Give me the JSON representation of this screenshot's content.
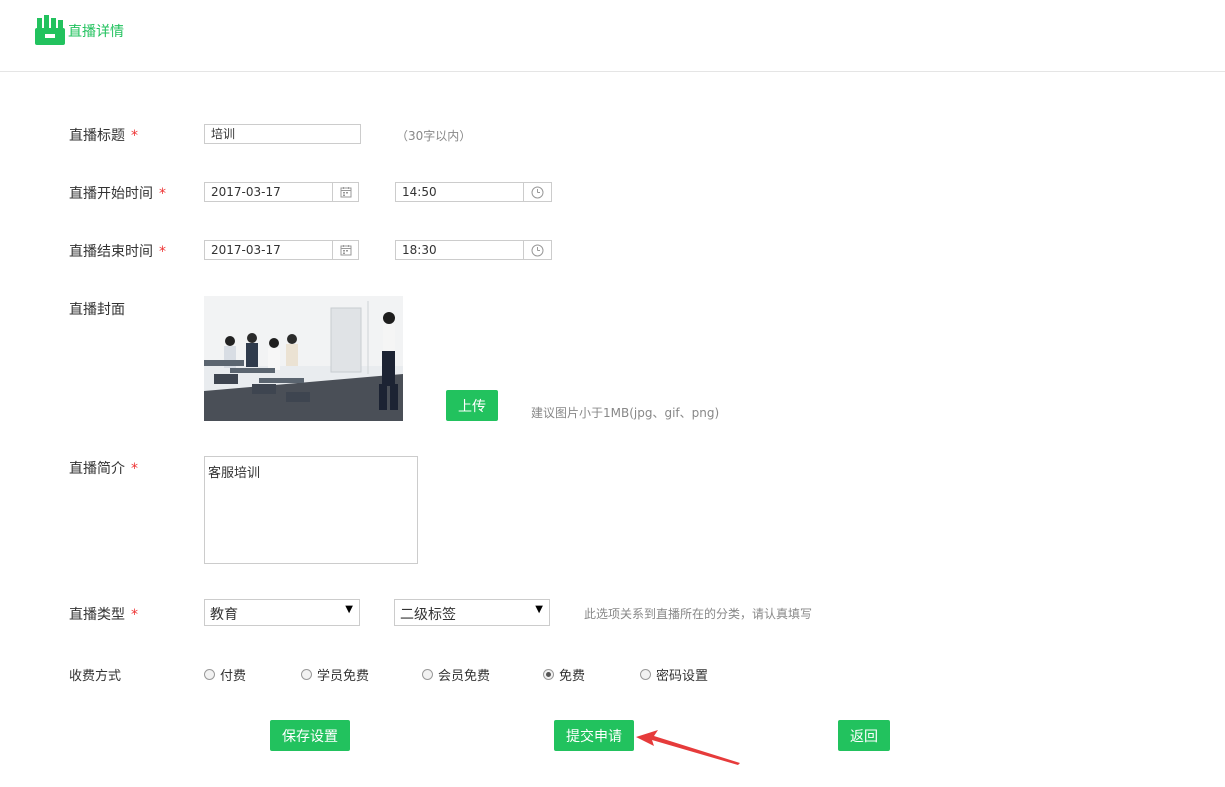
{
  "header": {
    "title": "直播详情"
  },
  "form": {
    "title_label": "直播标题",
    "title_value": "培训",
    "title_hint": "（30字以内）",
    "start_label": "直播开始时间",
    "start_date": "2017-03-17",
    "start_time": "14:50",
    "end_label": "直播结束时间",
    "end_date": "2017-03-17",
    "end_time": "18:30",
    "cover_label": "直播封面",
    "upload_button": "上传",
    "upload_hint": "建议图片小于1MB(jpg、gif、png)",
    "intro_label": "直播简介",
    "intro_value": "客服培训",
    "type_label": "直播类型",
    "type_primary": "教育",
    "type_secondary": "二级标签",
    "type_hint": "此选项关系到直播所在的分类，请认真填写",
    "fee_label": "收费方式",
    "fee_options": [
      {
        "label": "付费",
        "checked": false
      },
      {
        "label": "学员免费",
        "checked": false
      },
      {
        "label": "会员免费",
        "checked": false
      },
      {
        "label": "免费",
        "checked": true
      },
      {
        "label": "密码设置",
        "checked": false
      }
    ],
    "required_mark": "*"
  },
  "actions": {
    "save": "保存设置",
    "submit": "提交申请",
    "back": "返回"
  },
  "colors": {
    "accent": "#22c25e",
    "required": "#e33333",
    "arrow": "#e63b3b"
  }
}
